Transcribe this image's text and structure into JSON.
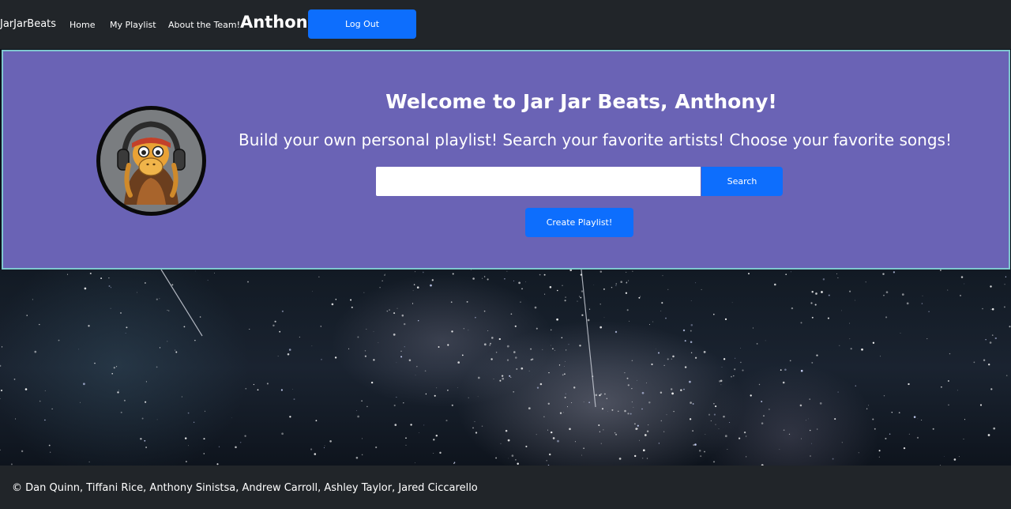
{
  "navbar": {
    "brand": "JarJarBeats",
    "links": [
      {
        "label": "Home"
      },
      {
        "label": "My Playlist"
      },
      {
        "label": "About the Team!"
      }
    ],
    "username": "Anthony",
    "logout_label": "Log Out"
  },
  "hero": {
    "avatar_icon": "jar-jar-headphones-logo",
    "title": "Welcome to Jar Jar Beats, Anthony!",
    "subtitle": "Build your own personal playlist! Search your favorite artists! Choose your favorite songs!",
    "search": {
      "value": "",
      "placeholder": ""
    },
    "search_button_label": "Search",
    "create_playlist_label": "Create Playlist!"
  },
  "background": {
    "image": "starry-night-sky"
  },
  "footer": {
    "text": "© Dan Quinn, Tiffani Rice, Anthony Sinistsa, Andrew Carroll, Ashley Taylor, Jared Ciccarello"
  },
  "colors": {
    "navbar_bg": "#212529",
    "hero_bg": "#6a63b5",
    "hero_border": "#7fc7cf",
    "primary_button": "#0d6efd"
  }
}
